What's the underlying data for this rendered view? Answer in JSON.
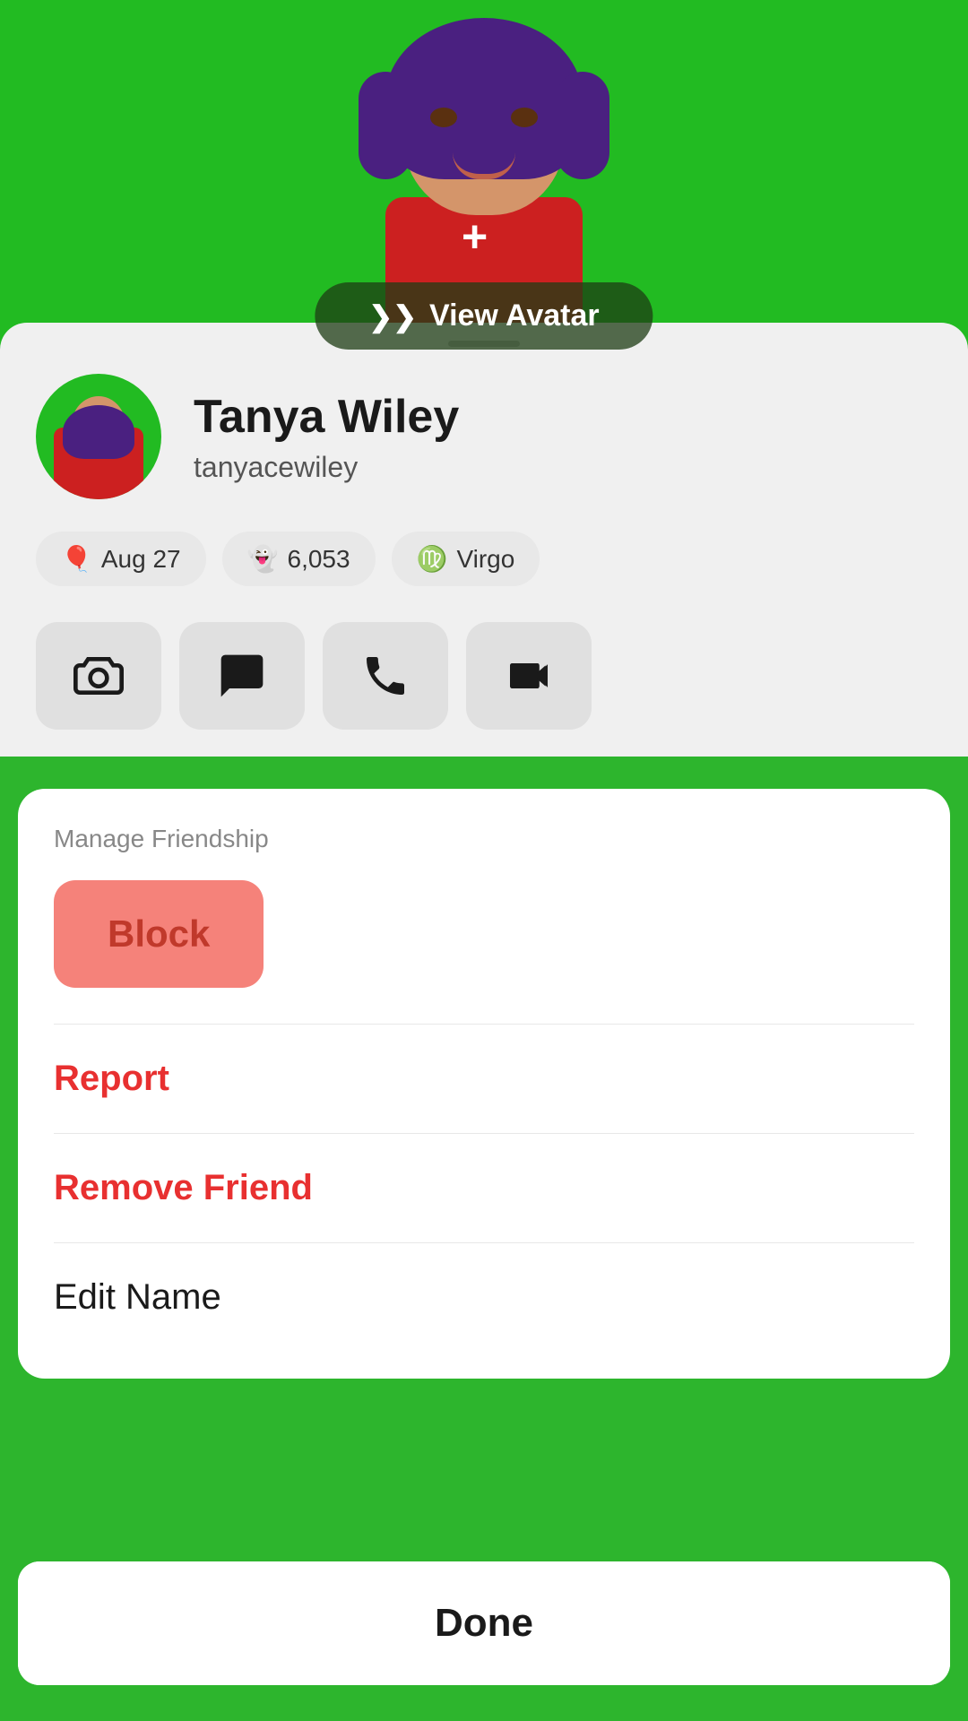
{
  "avatar": {
    "view_label": "View Avatar",
    "chevron": "❯❯"
  },
  "profile": {
    "name": "Tanya Wiley",
    "username": "tanyacewiley",
    "badges": [
      {
        "icon": "🎈",
        "label": "Aug 27"
      },
      {
        "icon": "👻",
        "label": "6,053"
      },
      {
        "icon": "♍",
        "label": "Virgo"
      }
    ]
  },
  "actions": [
    {
      "name": "camera",
      "icon": "camera"
    },
    {
      "name": "chat",
      "icon": "chat"
    },
    {
      "name": "phone",
      "icon": "phone"
    },
    {
      "name": "video",
      "icon": "video"
    }
  ],
  "manage_friendship": {
    "title": "Manage Friendship",
    "block_label": "Block",
    "report_label": "Report",
    "remove_friend_label": "Remove Friend",
    "edit_name_label": "Edit Name"
  },
  "done_label": "Done",
  "colors": {
    "background_green": "#22bb22",
    "danger_red": "#e83030",
    "block_bg": "#f5827a",
    "block_text": "#c0392b"
  }
}
